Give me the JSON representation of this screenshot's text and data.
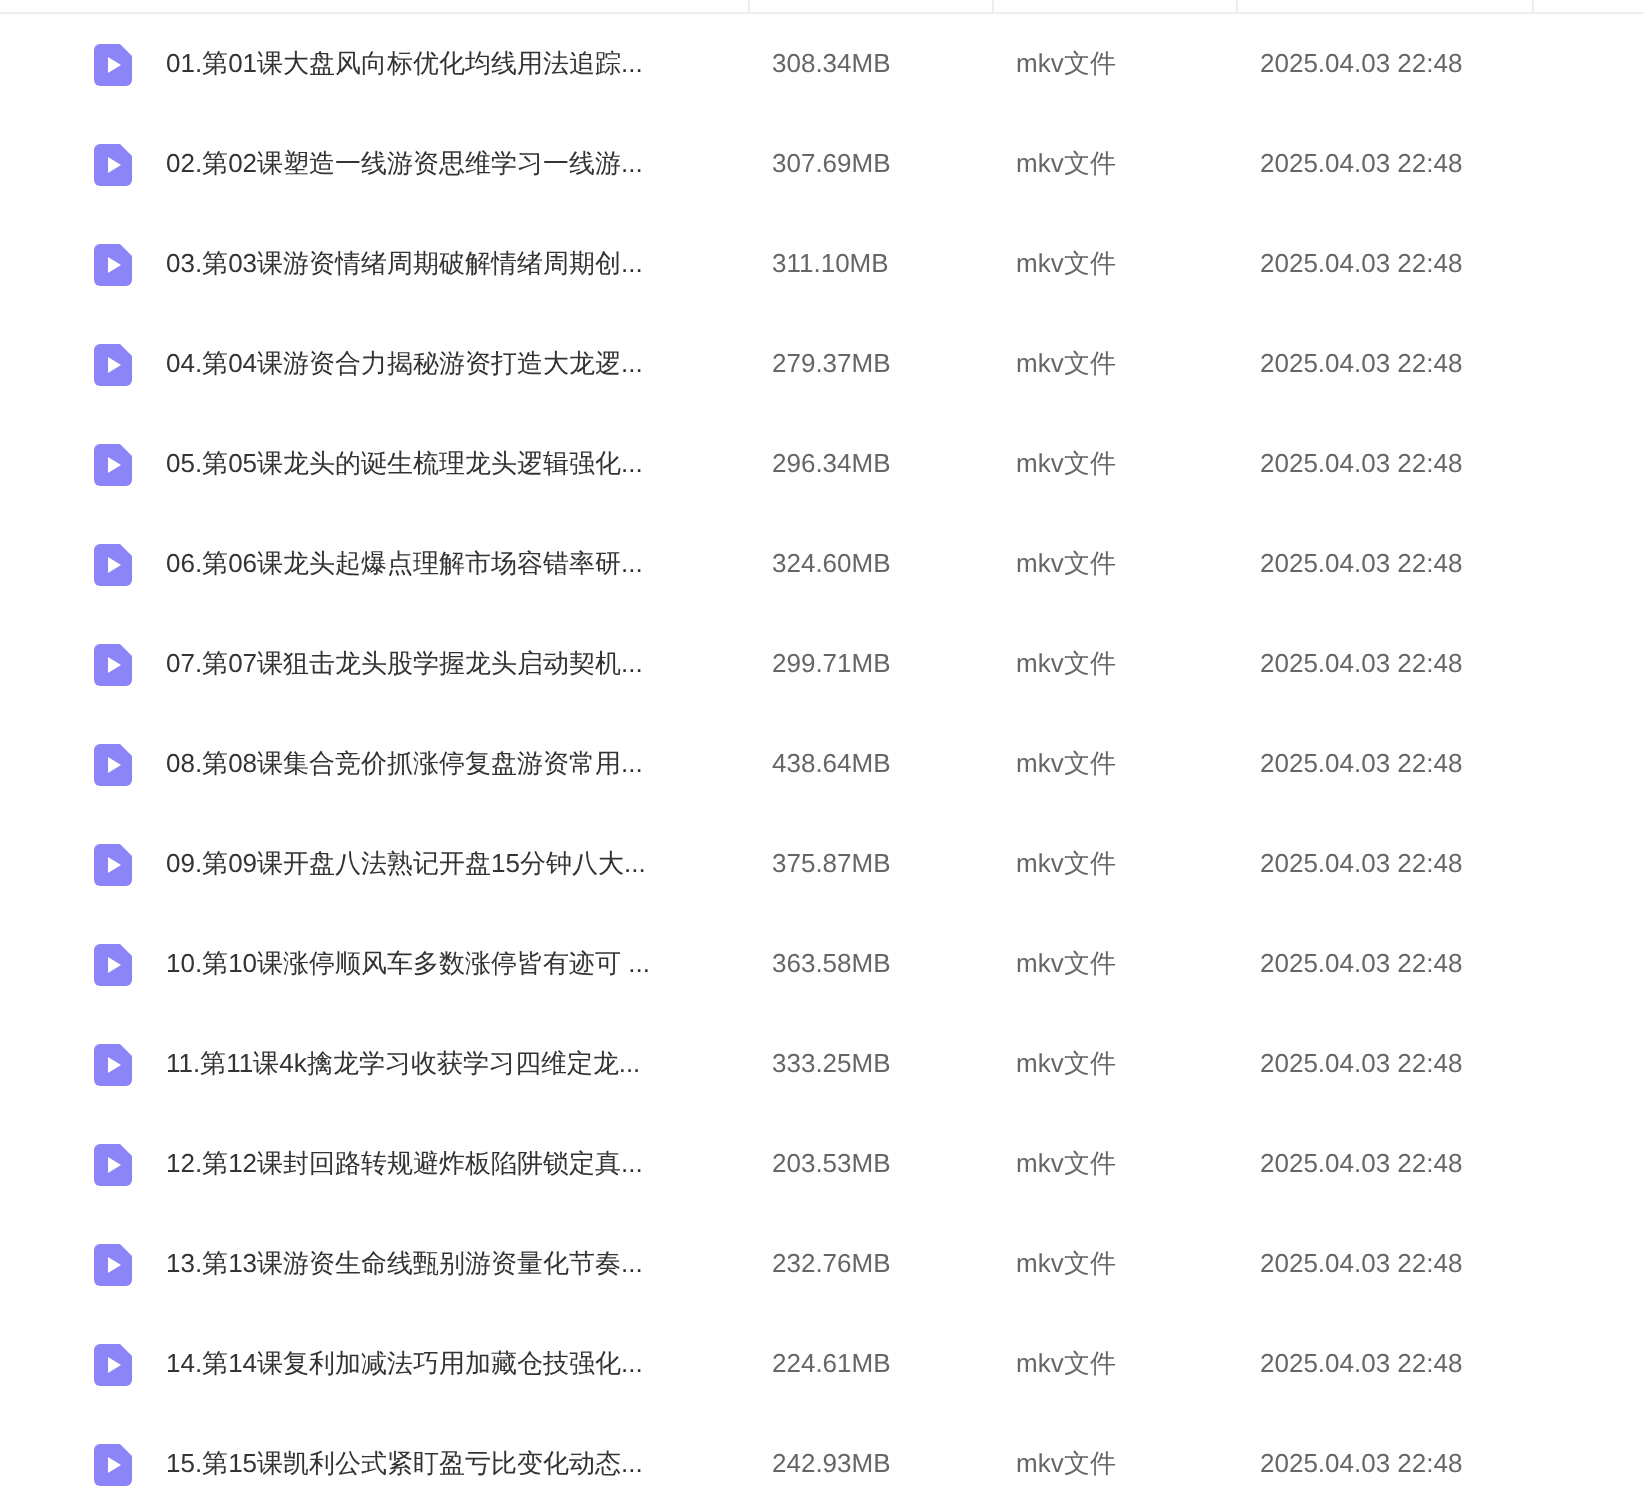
{
  "files": [
    {
      "name": "01.第01课大盘风向标优化均线用法追踪...",
      "size": "308.34MB",
      "type": "mkv文件",
      "modified": "2025.04.03 22:48"
    },
    {
      "name": "02.第02课塑造一线游资思维学习一线游...",
      "size": "307.69MB",
      "type": "mkv文件",
      "modified": "2025.04.03 22:48"
    },
    {
      "name": "03.第03课游资情绪周期破解情绪周期创...",
      "size": "311.10MB",
      "type": "mkv文件",
      "modified": "2025.04.03 22:48"
    },
    {
      "name": "04.第04课游资合力揭秘游资打造大龙逻...",
      "size": "279.37MB",
      "type": "mkv文件",
      "modified": "2025.04.03 22:48"
    },
    {
      "name": "05.第05课龙头的诞生梳理龙头逻辑强化...",
      "size": "296.34MB",
      "type": "mkv文件",
      "modified": "2025.04.03 22:48"
    },
    {
      "name": "06.第06课龙头起爆点理解市场容错率研...",
      "size": "324.60MB",
      "type": "mkv文件",
      "modified": "2025.04.03 22:48"
    },
    {
      "name": "07.第07课狙击龙头股学握龙头启动契机...",
      "size": "299.71MB",
      "type": "mkv文件",
      "modified": "2025.04.03 22:48"
    },
    {
      "name": "08.第08课集合竞价抓涨停复盘游资常用...",
      "size": "438.64MB",
      "type": "mkv文件",
      "modified": "2025.04.03 22:48"
    },
    {
      "name": "09.第09课开盘八法熟记开盘15分钟八大...",
      "size": "375.87MB",
      "type": "mkv文件",
      "modified": "2025.04.03 22:48"
    },
    {
      "name": "10.第10课涨停顺风车多数涨停皆有迹可 ...",
      "size": "363.58MB",
      "type": "mkv文件",
      "modified": "2025.04.03 22:48"
    },
    {
      "name": "11.第11课4k擒龙学习收获学习四维定龙...",
      "size": "333.25MB",
      "type": "mkv文件",
      "modified": "2025.04.03 22:48"
    },
    {
      "name": "12.第12课封回路转规避炸板陷阱锁定真...",
      "size": "203.53MB",
      "type": "mkv文件",
      "modified": "2025.04.03 22:48"
    },
    {
      "name": "13.第13课游资生命线甄别游资量化节奏...",
      "size": "232.76MB",
      "type": "mkv文件",
      "modified": "2025.04.03 22:48"
    },
    {
      "name": "14.第14课复利加减法巧用加藏仓技强化...",
      "size": "224.61MB",
      "type": "mkv文件",
      "modified": "2025.04.03 22:48"
    },
    {
      "name": "15.第15课凯利公式紧盯盈亏比变化动态...",
      "size": "242.93MB",
      "type": "mkv文件",
      "modified": "2025.04.03 22:48"
    }
  ]
}
